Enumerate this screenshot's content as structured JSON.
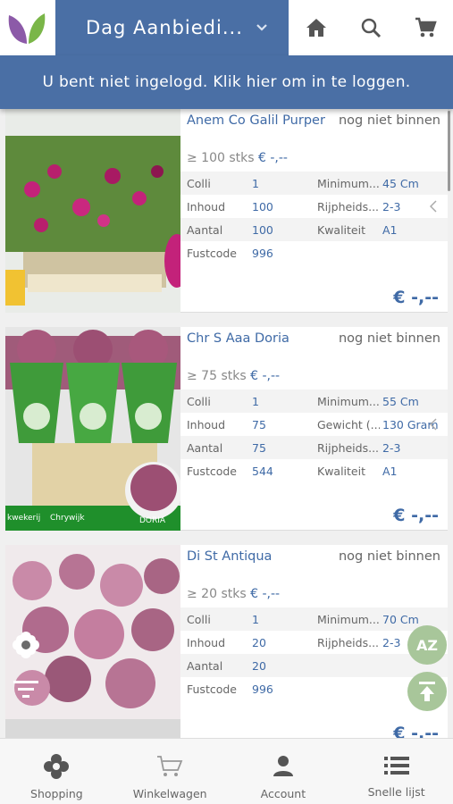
{
  "header": {
    "title": "Dag Aanbiedi...",
    "icons": [
      "logo-icon",
      "chevron-down-icon",
      "home-icon",
      "search-icon",
      "cart-icon"
    ]
  },
  "login_banner": "U bent niet ingelogd. Klik hier om in te loggen.",
  "products": [
    {
      "name": "Anem Co Galil Purper",
      "status": "nog niet binnen",
      "stock": "≥ 100 stks",
      "stock_price": "€ -,--",
      "rows": [
        {
          "l1": "Colli",
          "v1": "1",
          "l2": "Minimum...",
          "v2": "45 Cm"
        },
        {
          "l1": "Inhoud",
          "v1": "100",
          "l2": "Rijpheids...",
          "v2": "2-3"
        },
        {
          "l1": "Aantal",
          "v1": "100",
          "l2": "Kwaliteit",
          "v2": "A1"
        },
        {
          "l1": "Fustcode",
          "v1": "996",
          "l2": "",
          "v2": ""
        }
      ],
      "price": "€ -,--"
    },
    {
      "name": "Chr S Aaa Doria",
      "status": "nog niet binnen",
      "stock": "≥ 75 stks",
      "stock_price": "€ -,--",
      "rows": [
        {
          "l1": "Colli",
          "v1": "1",
          "l2": "Minimum...",
          "v2": "55 Cm"
        },
        {
          "l1": "Inhoud",
          "v1": "75",
          "l2": "Gewicht (...",
          "v2": "130 Gram"
        },
        {
          "l1": "Aantal",
          "v1": "75",
          "l2": "Rijpheids...",
          "v2": "2-3"
        },
        {
          "l1": "Fustcode",
          "v1": "544",
          "l2": "Kwaliteit",
          "v2": "A1"
        }
      ],
      "price": "€ -,--",
      "photo_text": [
        "kwekerij",
        "Chrywijk",
        "DORIA"
      ]
    },
    {
      "name": "Di St Antiqua",
      "status": "nog niet binnen",
      "stock": "≥ 20 stks",
      "stock_price": "€ -,--",
      "rows": [
        {
          "l1": "Colli",
          "v1": "1",
          "l2": "Minimum...",
          "v2": "70 Cm"
        },
        {
          "l1": "Inhoud",
          "v1": "20",
          "l2": "Rijpheids...",
          "v2": "2-3"
        },
        {
          "l1": "Aantal",
          "v1": "20",
          "l2": "",
          "v2": ""
        },
        {
          "l1": "Fustcode",
          "v1": "996",
          "l2": "",
          "v2": ""
        }
      ],
      "price": "€ -,--"
    }
  ],
  "floating": {
    "sort_label": "AZ"
  },
  "bottom_nav": [
    {
      "label": "Shopping",
      "icon": "flower-icon"
    },
    {
      "label": "Winkelwagen",
      "icon": "cart-icon"
    },
    {
      "label": "Account",
      "icon": "person-icon"
    },
    {
      "label": "Snelle lijst",
      "icon": "list-icon"
    }
  ],
  "colors": {
    "primary": "#4a6fa5",
    "link": "#3f6aa6",
    "fab": "#a8c69a"
  }
}
